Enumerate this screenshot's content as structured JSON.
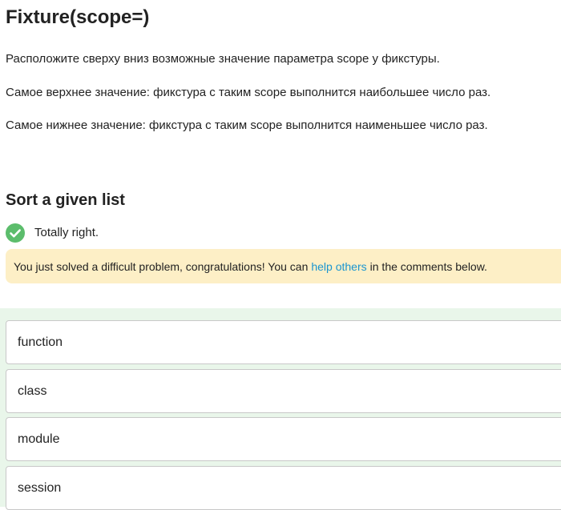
{
  "header": {
    "title": "Fixture(scope=)"
  },
  "description": {
    "paragraphs": [
      "Расположите сверху вниз возможные значение параметра scope у фикстуры.",
      "Самое верхнее значение: фикстура с таким scope выполнится наибольшее число раз.",
      "Самое нижнее значение: фикстура с таким scope выполнится наименьшее число раз."
    ]
  },
  "task": {
    "title": "Sort a given list",
    "result_text": "Totally right.",
    "result_icon": "checkmark-circle-icon",
    "success_color": "#5cbd6c"
  },
  "notice": {
    "text_before": "You just solved a difficult problem, congratulations! You can",
    "link_text": "help others",
    "text_after": "in the comments below.",
    "background": "#fdefc6",
    "link_color": "#1a95d0"
  },
  "options": {
    "items": [
      "function",
      "class",
      "module",
      "session"
    ],
    "area_color": "#e9f6ea"
  }
}
